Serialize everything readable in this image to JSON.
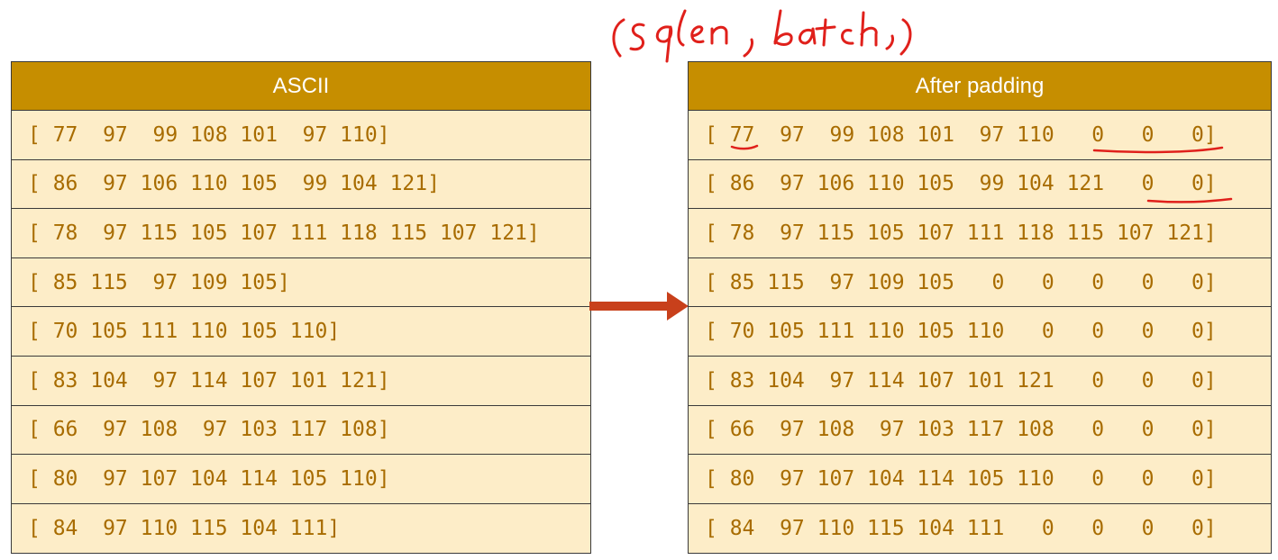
{
  "left_table": {
    "header": "ASCII",
    "rows": [
      "[ 77  97  99 108 101  97 110]",
      "[ 86  97 106 110 105  99 104 121]",
      "[ 78  97 115 105 107 111 118 115 107 121]",
      "[ 85 115  97 109 105]",
      "[ 70 105 111 110 105 110]",
      "[ 83 104  97 114 107 101 121]",
      "[ 66  97 108  97 103 117 108]",
      "[ 80  97 107 104 114 105 110]",
      "[ 84  97 110 115 104 111]"
    ]
  },
  "right_table": {
    "header": "After padding",
    "rows": [
      "[ 77  97  99 108 101  97 110   0   0   0]",
      "[ 86  97 106 110 105  99 104 121   0   0]",
      "[ 78  97 115 105 107 111 118 115 107 121]",
      "[ 85 115  97 109 105   0   0   0   0   0]",
      "[ 70 105 111 110 105 110   0   0   0   0]",
      "[ 83 104  97 114 107 101 121   0   0   0]",
      "[ 66  97 108  97 103 117 108   0   0   0]",
      "[ 80  97 107 104 114 105 110   0   0   0]",
      "[ 84  97 110 115 104 111   0   0   0   0]"
    ]
  },
  "handwritten_note": "(sqlen , batch ,)",
  "colors": {
    "header_bg": "#c68e00",
    "cell_bg": "#fdedc8",
    "text": "#a86c00",
    "arrow": "#c8401b",
    "ink": "#e0201b"
  }
}
